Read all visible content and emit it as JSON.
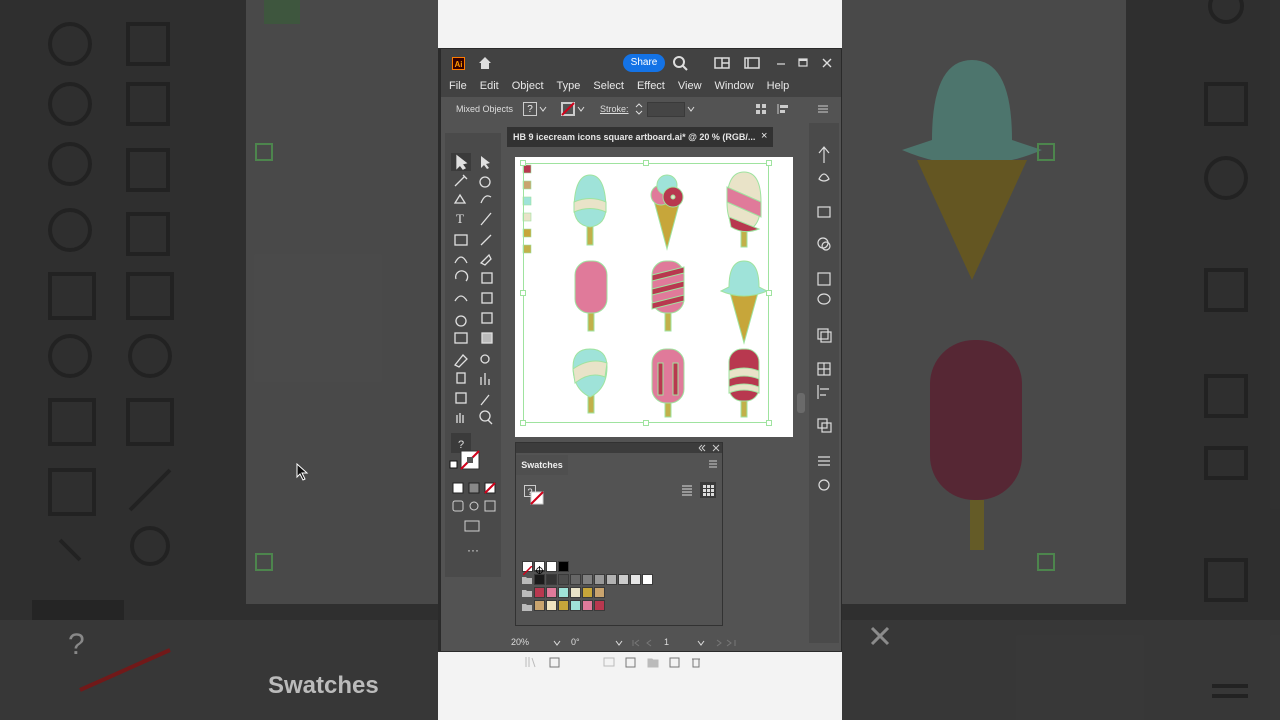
{
  "window": {
    "app_icon": "Ai",
    "share_label": "Share"
  },
  "menu": [
    "File",
    "Edit",
    "Object",
    "Type",
    "Select",
    "Effect",
    "View",
    "Window",
    "Help"
  ],
  "control_bar": {
    "selection_label": "Mixed Objects",
    "fill_value": "?",
    "stroke_label": "Stroke:"
  },
  "document": {
    "tab_title": "HB 9 icecream icons square artboard.ai* @ 20 % (RGB/...",
    "close": "×"
  },
  "swatches_panel": {
    "title": "Swatches",
    "fill_value": "?",
    "rows": [
      [
        "#ffffff",
        "#000000",
        "#ffffff",
        "#000000"
      ],
      [
        "#1a1a1a",
        "#333333",
        "#4d4d4d",
        "#666666",
        "#808080",
        "#999999",
        "#b3b3b3",
        "#cccccc",
        "#e6e6e6",
        "#ffffff"
      ],
      [
        "#b8384f",
        "#e07a9a",
        "#9fe3d9",
        "#e9e3c8",
        "#c7a63a",
        "#c9a46e"
      ],
      [
        "#c9a46e",
        "#f0e4c0",
        "#c7a63a",
        "#9fe3d9",
        "#e07a9a",
        "#b8384f"
      ]
    ]
  },
  "status_bar": {
    "zoom": "20%",
    "rotation": "0°",
    "artboard": "1"
  },
  "toolbar": {
    "fill_value": "?"
  },
  "background": {
    "swatches_label": "Swatches",
    "fill_value": "?"
  },
  "colors": {
    "share_blue": "#1473e6",
    "selection_green": "#9fe39f",
    "panel_gray": "#535353",
    "mint": "#9fe3d9",
    "pink": "#e07a9a",
    "crimson": "#b8384f",
    "cone": "#c7a63a",
    "stick": "#c2b04a"
  }
}
